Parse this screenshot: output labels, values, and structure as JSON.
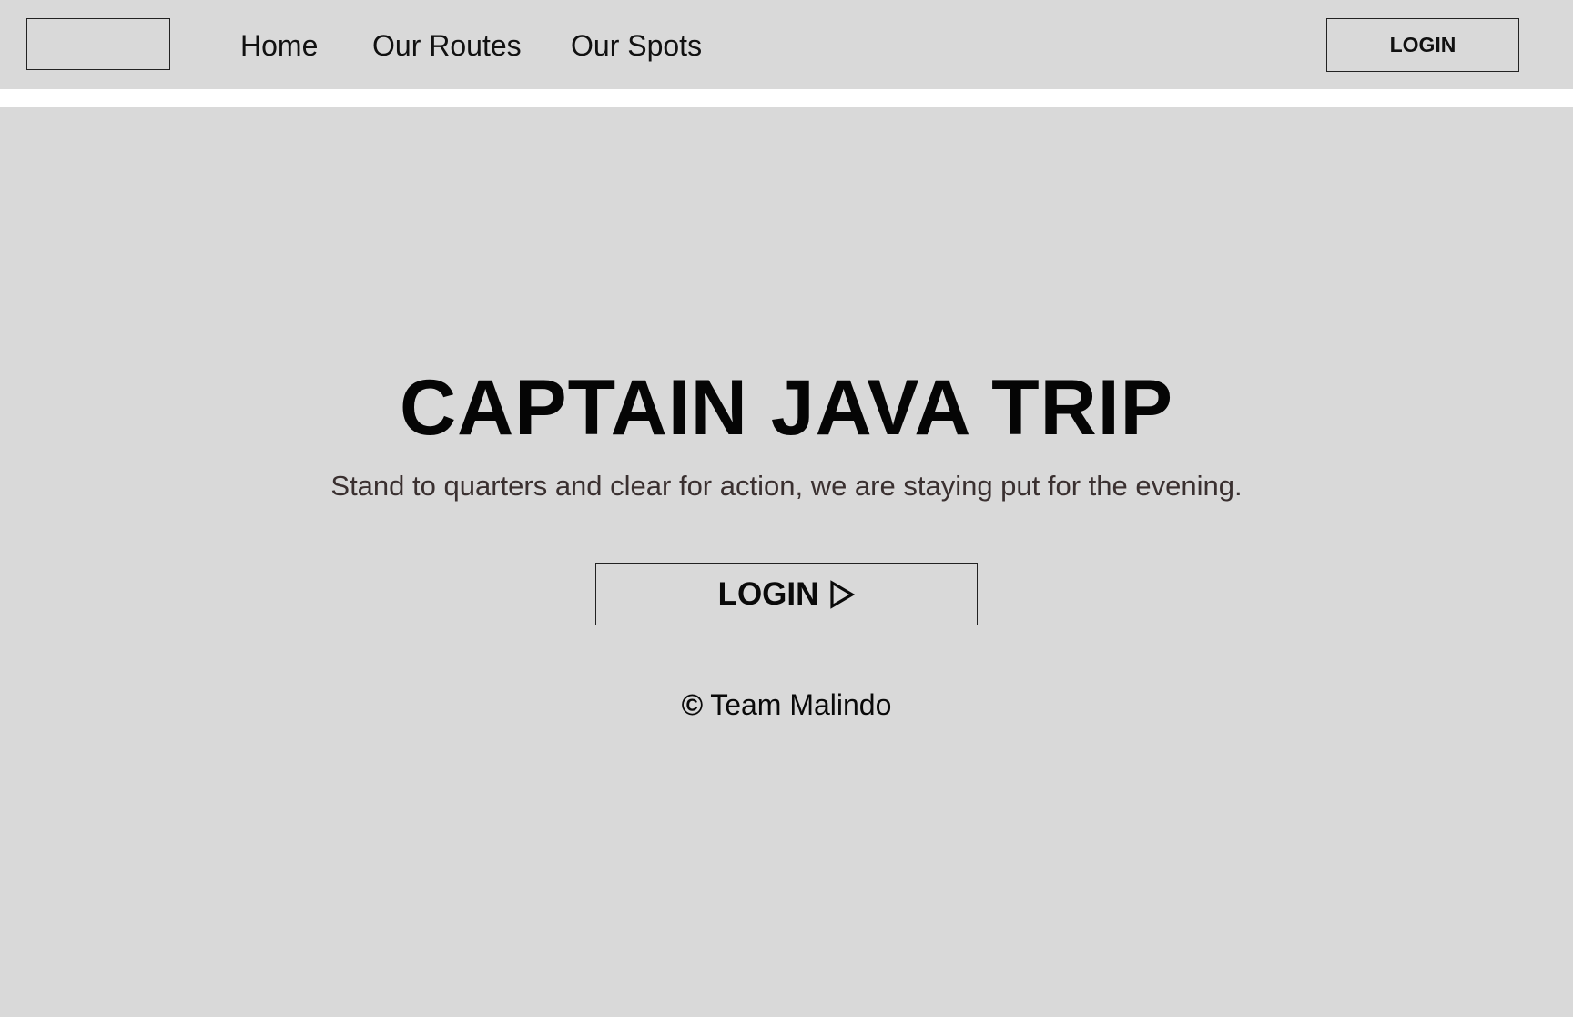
{
  "header": {
    "logo_label": "",
    "nav": {
      "home": "Home",
      "routes": "Our Routes",
      "spots": "Our Spots"
    },
    "login_label": "LOGIN"
  },
  "hero": {
    "title": "CAPTAIN JAVA TRIP",
    "subtitle": "Stand to quarters and clear for action, we are staying put for the evening.",
    "login_label": "LOGIN",
    "login_icon": "play-triangle-icon"
  },
  "footer": {
    "copyright_symbol": "©",
    "credit": "Team Malindo"
  },
  "colors": {
    "panel_background": "#d9d9d9",
    "page_background": "#ffffff",
    "text": "#0a0a0a",
    "subtitle_text": "#3a3030",
    "border": "#222222"
  }
}
